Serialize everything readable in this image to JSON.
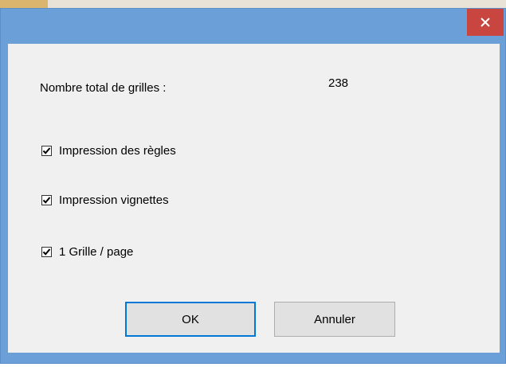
{
  "dialog": {
    "close_glyph": "✕",
    "total_label": "Nombre total de grilles :",
    "total_value": "238",
    "options": [
      {
        "label": "Impression des règles",
        "checked": true
      },
      {
        "label": "Impression vignettes",
        "checked": true
      },
      {
        "label": "1 Grille / page",
        "checked": true
      }
    ],
    "buttons": {
      "ok_label": "OK",
      "cancel_label": "Annuler"
    }
  },
  "colors": {
    "titlebar": "#6a9fd8",
    "close_button": "#c9453f",
    "client_background": "#f0f0f0",
    "button_face": "#e1e1e1",
    "focus_border": "#0078d7"
  },
  "icons": {
    "close": "close-icon",
    "check": "checkmark-icon"
  }
}
